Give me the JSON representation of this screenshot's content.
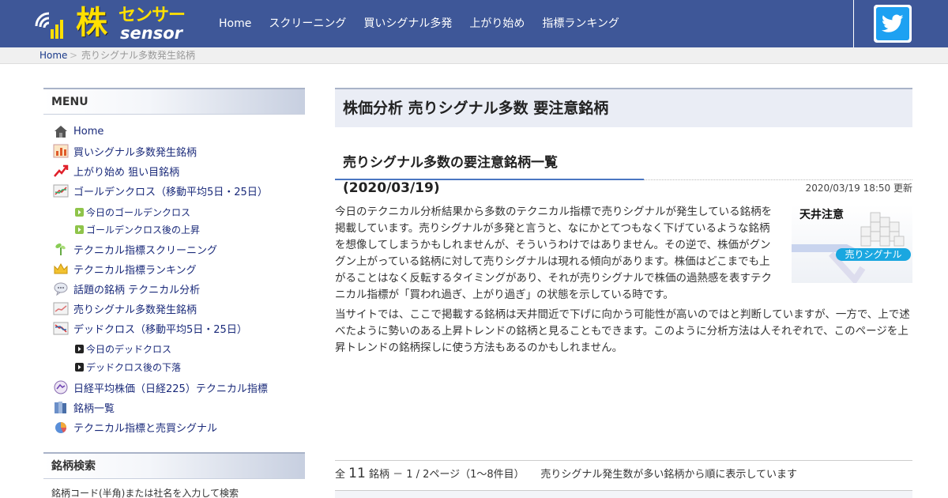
{
  "header": {
    "logo_kanji": "株",
    "logo_katakana": "センサー",
    "logo_english": "sensor",
    "nav": [
      "Home",
      "スクリーニング",
      "買いシグナル多発",
      "上がり始め",
      "指標ランキング"
    ],
    "twitter_icon": "twitter-bird-icon"
  },
  "breadcrumb": {
    "home": "Home",
    "separator": ">",
    "current": "売りシグナル多数発生銘柄"
  },
  "sidebar": {
    "menu_title": "MENU",
    "menu_items": [
      "Home",
      "買いシグナル多数発生銘柄",
      "上がり始め 狙い目銘柄",
      "ゴールデンクロス（移動平均5日・25日）",
      "テクニカル指標スクリーニング",
      "テクニカル指標ランキング",
      "話題の銘柄 テクニカル分析",
      "売りシグナル多数発生銘柄",
      "デッドクロス（移動平均5日・25日）",
      "日経平均株価（日経225）テクニカル指標",
      "銘柄一覧",
      "テクニカル指標と売買シグナル"
    ],
    "golden_sub": [
      "今日のゴールデンクロス",
      "ゴールデンクロス後の上昇"
    ],
    "dead_sub": [
      "今日のデッドクロス",
      "デッドクロス後の下落"
    ],
    "search_title": "銘柄検索",
    "search_desc": "銘柄コード(半角)または社名を入力して検索"
  },
  "main": {
    "title": "株価分析 売りシグナル多数 要注意銘柄",
    "subtitle": "売りシグナル多数の要注意銘柄一覧 (2020/03/19)",
    "updated": "2020/03/19 18:50 更新",
    "paragraph1": "今日のテクニカル分析結果から多数のテクニカル指標で売りシグナルが発生している銘柄を掲載しています。売りシグナルが多発と言うと、なにかとてつもなく下げているような銘柄を想像してしまうかもしれませんが、そういうわけではありません。その逆で、株価がグングン上がっている銘柄に対して売りシグナルは現れる傾向があります。株価はどこまでも上がることはなく反転するタイミングがあり、それが売りシグナルで株価の過熱感を表すテクニカル指標が「買われ過ぎ、上がり過ぎ」の状態を示している時です。",
    "paragraph2": "当サイトでは、ここで掲載する銘柄は天井間近で下げに向かう可能性が高いのではと判断していますが、一方で、上で述べたように勢いのある上昇トレンドの銘柄と見ることもできます。このように分析方法は人それぞれで、このページを上昇トレンドの銘柄探しに使う方法もあるのかもしれません。",
    "image_label_top": "天井注意",
    "image_label_badge": "売りシグナル",
    "summary": {
      "prefix": "全",
      "count": "11",
      "suffix": "銘柄 － 1 / 2ページ（1～8件目）",
      "note": "売りシグナル発生数が多い銘柄から順に表示しています"
    }
  }
}
